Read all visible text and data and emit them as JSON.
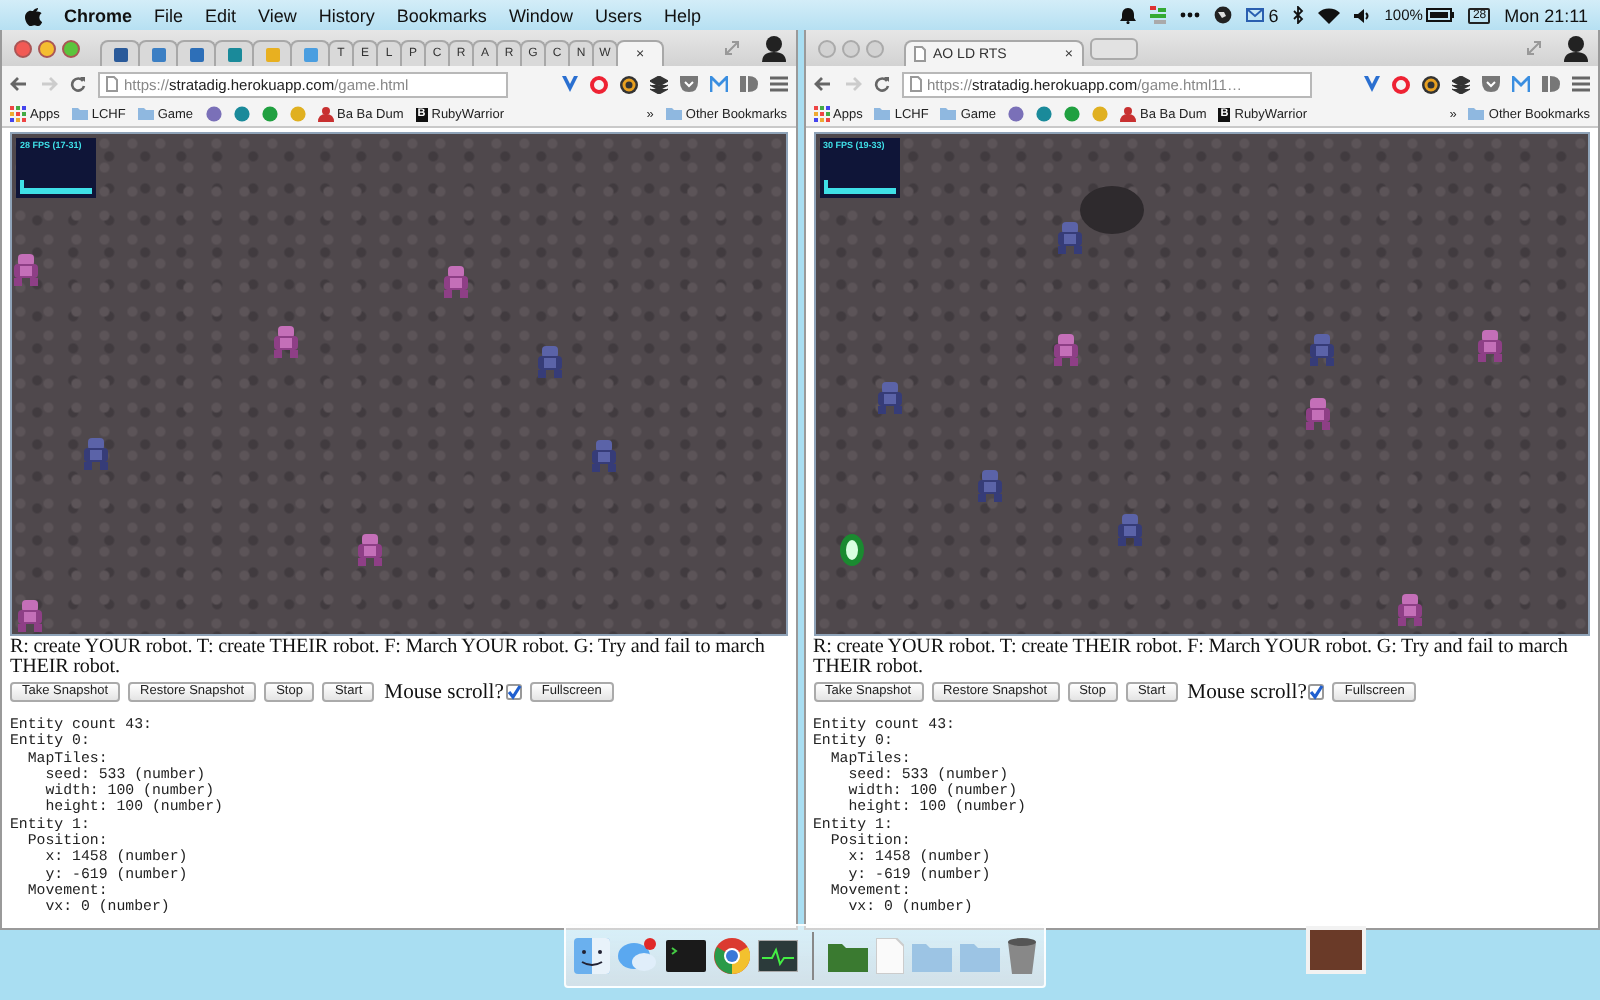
{
  "menu_bar": {
    "app": "Chrome",
    "items": [
      "File",
      "Edit",
      "View",
      "History",
      "Bookmarks",
      "Window",
      "Users",
      "Help"
    ],
    "mail_count": "6",
    "battery": "100%",
    "calendar_day": "28",
    "clock": "Mon 21:11"
  },
  "windows": [
    {
      "focused": true,
      "tabs": [
        {
          "kind": "icon",
          "color": "#2a5a9a",
          "selected": false
        },
        {
          "kind": "icon",
          "color": "#3b7fc4",
          "selected": false
        },
        {
          "kind": "icon",
          "color": "#2d6fb8",
          "selected": false
        },
        {
          "kind": "icon",
          "color": "#1a8a9a",
          "selected": false
        },
        {
          "kind": "icon",
          "color": "#e8b020",
          "selected": false
        },
        {
          "kind": "icon",
          "color": "#4a9ee0",
          "selected": false
        },
        {
          "kind": "letter",
          "label": "T",
          "selected": false
        },
        {
          "kind": "letter",
          "label": "E",
          "selected": false
        },
        {
          "kind": "letter",
          "label": "L",
          "selected": false
        },
        {
          "kind": "letter",
          "label": "P",
          "selected": false
        },
        {
          "kind": "letter",
          "label": "C",
          "selected": false
        },
        {
          "kind": "letter",
          "label": "R",
          "selected": false
        },
        {
          "kind": "letter",
          "label": "A",
          "selected": false
        },
        {
          "kind": "letter",
          "label": "R",
          "selected": false
        },
        {
          "kind": "letter",
          "label": "G",
          "selected": false
        },
        {
          "kind": "letter",
          "label": "C",
          "selected": false
        },
        {
          "kind": "letter",
          "label": "N",
          "selected": false
        },
        {
          "kind": "letter",
          "label": "W",
          "selected": false
        },
        {
          "kind": "page",
          "close": "×",
          "selected": true
        }
      ],
      "url": {
        "scheme": "https://",
        "host": "stratadig.herokuapp.com",
        "path": "/game.html"
      },
      "bookmarks": {
        "items": [
          {
            "kind": "apps",
            "label": "Apps"
          },
          {
            "kind": "folder",
            "label": "LCHF"
          },
          {
            "kind": "folder",
            "label": "Game"
          },
          {
            "kind": "favicon",
            "color": "#7a70b8"
          },
          {
            "kind": "favicon",
            "color": "#1a8a9a"
          },
          {
            "kind": "favicon",
            "color": "#20a040"
          },
          {
            "kind": "favicon",
            "color": "#e0b020"
          },
          {
            "kind": "favicon",
            "label": "Ba Ba Dum",
            "color": "#c83030"
          },
          {
            "kind": "badge",
            "badge": "B",
            "label": "RubyWarrior"
          }
        ],
        "overflow": "»",
        "other": "Other Bookmarks"
      },
      "page": {
        "fps": "28 FPS (17-31)",
        "help": "R: create YOUR robot. T: create THEIR robot. F: March YOUR robot. G: Try and fail to march THEIR robot.",
        "controls": [
          {
            "kind": "button",
            "label": "Take Snapshot"
          },
          {
            "kind": "button",
            "label": "Restore Snapshot"
          },
          {
            "kind": "button",
            "label": "Stop"
          },
          {
            "kind": "button",
            "label": "Start"
          },
          {
            "kind": "checkbox",
            "label": "Mouse scroll?",
            "checked": true
          },
          {
            "kind": "button",
            "label": "Fullscreen"
          }
        ],
        "debug": [
          {
            "text": "Entity count 43:"
          },
          {
            "text": "Entity 0:",
            "children": [
              {
                "text": "MapTiles:",
                "children": [
                  {
                    "text": "seed: 533 (number)"
                  },
                  {
                    "text": "width: 100 (number)"
                  },
                  {
                    "text": "height: 100 (number)"
                  }
                ]
              }
            ]
          },
          {
            "text": "Entity 1:",
            "children": [
              {
                "text": "Position:",
                "children": [
                  {
                    "text": "x: 1458 (number)"
                  },
                  {
                    "text": "y: -619 (number)"
                  }
                ]
              },
              {
                "text": "Movement:",
                "children": [
                  {
                    "text": "vx: 0 (number)"
                  }
                ]
              }
            ]
          }
        ]
      }
    },
    {
      "focused": false,
      "tabs": [
        {
          "kind": "page",
          "label": "AO LD RTS",
          "close": "×",
          "selected": true
        }
      ],
      "url": {
        "scheme": "https://",
        "host": "stratadig.herokuapp.com",
        "path": "/game.html11…"
      },
      "bookmarks": {
        "items": [
          {
            "kind": "apps",
            "label": "Apps"
          },
          {
            "kind": "folder",
            "label": "LCHF"
          },
          {
            "kind": "folder",
            "label": "Game"
          },
          {
            "kind": "favicon",
            "color": "#7a70b8"
          },
          {
            "kind": "favicon",
            "color": "#1a8a9a"
          },
          {
            "kind": "favicon",
            "color": "#20a040"
          },
          {
            "kind": "favicon",
            "color": "#e0b020"
          },
          {
            "kind": "favicon",
            "label": "Ba Ba Dum",
            "color": "#c83030"
          },
          {
            "kind": "badge",
            "badge": "B",
            "label": "RubyWarrior"
          }
        ],
        "overflow": "»",
        "other": "Other Bookmarks"
      },
      "page": {
        "fps": "30 FPS (19-33)",
        "help": "R: create YOUR robot. T: create THEIR robot. F: March YOUR robot. G: Try and fail to march THEIR robot.",
        "controls": [
          {
            "kind": "button",
            "label": "Take Snapshot"
          },
          {
            "kind": "button",
            "label": "Restore Snapshot"
          },
          {
            "kind": "button",
            "label": "Stop"
          },
          {
            "kind": "button",
            "label": "Start"
          },
          {
            "kind": "checkbox",
            "label": "Mouse scroll?",
            "checked": true
          },
          {
            "kind": "button",
            "label": "Fullscreen"
          }
        ],
        "debug": [
          {
            "text": "Entity count 43:"
          },
          {
            "text": "Entity 0:",
            "children": [
              {
                "text": "MapTiles:",
                "children": [
                  {
                    "text": "seed: 533 (number)"
                  },
                  {
                    "text": "width: 100 (number)"
                  },
                  {
                    "text": "height: 100 (number)"
                  }
                ]
              }
            ]
          },
          {
            "text": "Entity 1:",
            "children": [
              {
                "text": "Position:",
                "children": [
                  {
                    "text": "x: 1458 (number)"
                  },
                  {
                    "text": "y: -619 (number)"
                  }
                ]
              },
              {
                "text": "Movement:",
                "children": [
                  {
                    "text": "vx: 0 (number)"
                  }
                ]
              }
            ]
          }
        ]
      }
    }
  ]
}
